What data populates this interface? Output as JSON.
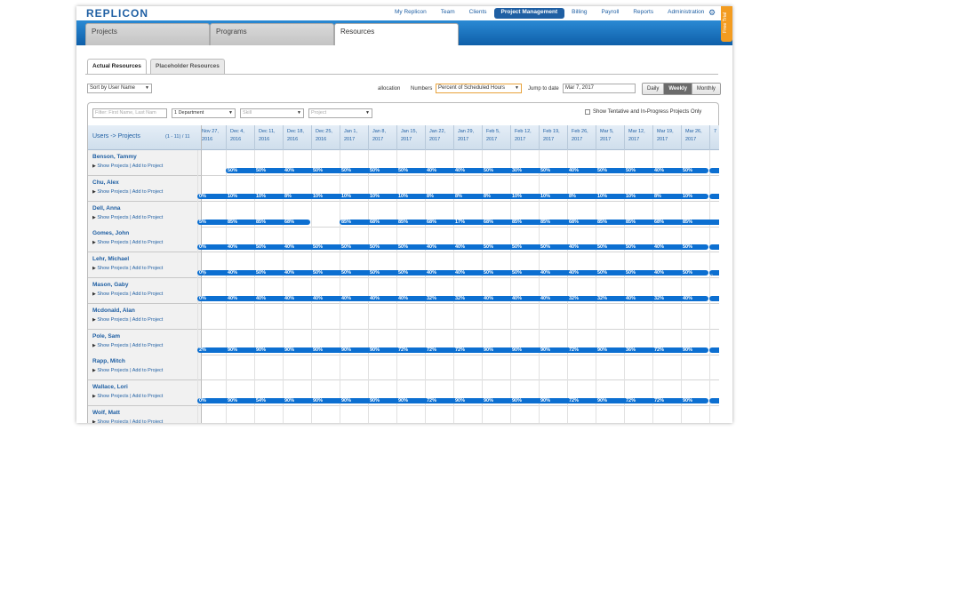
{
  "header": {
    "logo": "REPLICON",
    "nav": [
      "My Replicon",
      "Team",
      "Clients",
      "Project Management",
      "Billing",
      "Payroll",
      "Reports",
      "Administration"
    ],
    "active_nav": "Project Management",
    "free_trial": "Free Trial"
  },
  "main_tabs": [
    "Projects",
    "Programs",
    "Resources"
  ],
  "active_main_tab": "Resources",
  "sub_tabs": [
    "Actual Resources",
    "Placeholder Resources"
  ],
  "active_sub_tab": "Actual Resources",
  "controls": {
    "sort_value": "Sort by User Name",
    "allocation_label": "allocation",
    "numbers_label": "Numbers",
    "numbers_value": "Percent of Scheduled Hours",
    "jump_label": "Jump to date",
    "jump_value": "Mar 7, 2017",
    "views": [
      "Daily",
      "Weekly",
      "Monthly"
    ],
    "active_view": "Weekly"
  },
  "filters": {
    "name_placeholder": "Filter: First Name, Last Nam",
    "department_value": "1 Department",
    "skill_placeholder": "Skill",
    "project_placeholder": "Project",
    "tentative_label": "Show Tentative and In-Progress Projects Only"
  },
  "grid": {
    "users_header": "Users -> Projects",
    "count": "(1 - 11) / 11",
    "dates": [
      [
        "Nov 27,",
        "2016"
      ],
      [
        "Dec 4,",
        "2016"
      ],
      [
        "Dec 11,",
        "2016"
      ],
      [
        "Dec 18,",
        "2016"
      ],
      [
        "Dec 25,",
        "2016"
      ],
      [
        "Jan 1,",
        "2017"
      ],
      [
        "Jan 8,",
        "2017"
      ],
      [
        "Jan 15,",
        "2017"
      ],
      [
        "Jan 22,",
        "2017"
      ],
      [
        "Jan 29,",
        "2017"
      ],
      [
        "Feb 5,",
        "2017"
      ],
      [
        "Feb 12,",
        "2017"
      ],
      [
        "Feb 19,",
        "2017"
      ],
      [
        "Feb 26,",
        "2017"
      ],
      [
        "Mar 5,",
        "2017"
      ],
      [
        "Mar 12,",
        "2017"
      ],
      [
        "Mar 19,",
        "2017"
      ],
      [
        "Mar 26,",
        "2017"
      ],
      [
        "",
        "7"
      ]
    ],
    "show_projects": "Show Projects",
    "add_to_project": "Add to Project",
    "users": [
      {
        "name": "Benson, Tammy",
        "pcts": [
          "",
          "50%",
          "50%",
          "40%",
          "50%",
          "50%",
          "50%",
          "50%",
          "40%",
          "40%",
          "50%",
          "30%",
          "50%",
          "40%",
          "50%",
          "50%",
          "40%",
          "50%",
          ""
        ],
        "start": 1
      },
      {
        "name": "Chu, Alex",
        "pcts": [
          "0%",
          "10%",
          "10%",
          "8%",
          "10%",
          "10%",
          "10%",
          "10%",
          "8%",
          "8%",
          "8%",
          "10%",
          "10%",
          "8%",
          "10%",
          "10%",
          "8%",
          "10%",
          ""
        ],
        "start": 0
      },
      {
        "name": "Dell, Anna",
        "pcts": [
          "5%",
          "85%",
          "85%",
          "68%",
          "",
          "85%",
          "68%",
          "85%",
          "68%",
          "17%",
          "68%",
          "85%",
          "85%",
          "68%",
          "85%",
          "85%",
          "68%",
          "85%",
          ""
        ],
        "start": 0,
        "gap": 4
      },
      {
        "name": "Gomes, John",
        "pcts": [
          "0%",
          "40%",
          "50%",
          "40%",
          "50%",
          "50%",
          "50%",
          "50%",
          "40%",
          "40%",
          "50%",
          "50%",
          "50%",
          "40%",
          "50%",
          "50%",
          "40%",
          "50%",
          ""
        ],
        "start": 0
      },
      {
        "name": "Lehr, Michael",
        "pcts": [
          "0%",
          "40%",
          "50%",
          "40%",
          "50%",
          "50%",
          "50%",
          "50%",
          "40%",
          "40%",
          "50%",
          "50%",
          "40%",
          "40%",
          "50%",
          "50%",
          "40%",
          "50%",
          ""
        ],
        "start": 0
      },
      {
        "name": "Mason, Gaby",
        "pcts": [
          "0%",
          "40%",
          "40%",
          "40%",
          "40%",
          "40%",
          "40%",
          "40%",
          "32%",
          "32%",
          "40%",
          "40%",
          "40%",
          "32%",
          "32%",
          "40%",
          "32%",
          "40%",
          ""
        ],
        "start": 0
      },
      {
        "name": "Mcdonald, Alan",
        "pcts": [],
        "start": -1
      },
      {
        "name": "Pole, Sam",
        "pcts": [
          "2%",
          "90%",
          "90%",
          "90%",
          "90%",
          "90%",
          "90%",
          "72%",
          "72%",
          "72%",
          "90%",
          "90%",
          "90%",
          "72%",
          "90%",
          "36%",
          "72%",
          "90%",
          ""
        ],
        "start": 0
      },
      {
        "name": "Rapp, Mitch",
        "pcts": [],
        "start": -1
      },
      {
        "name": "Wallace, Lori",
        "pcts": [
          "0%",
          "90%",
          "54%",
          "90%",
          "90%",
          "90%",
          "90%",
          "90%",
          "72%",
          "90%",
          "90%",
          "90%",
          "90%",
          "72%",
          "90%",
          "72%",
          "72%",
          "90%",
          ""
        ],
        "start": 0
      },
      {
        "name": "Wolf, Matt",
        "pcts": [],
        "start": -1
      }
    ]
  }
}
